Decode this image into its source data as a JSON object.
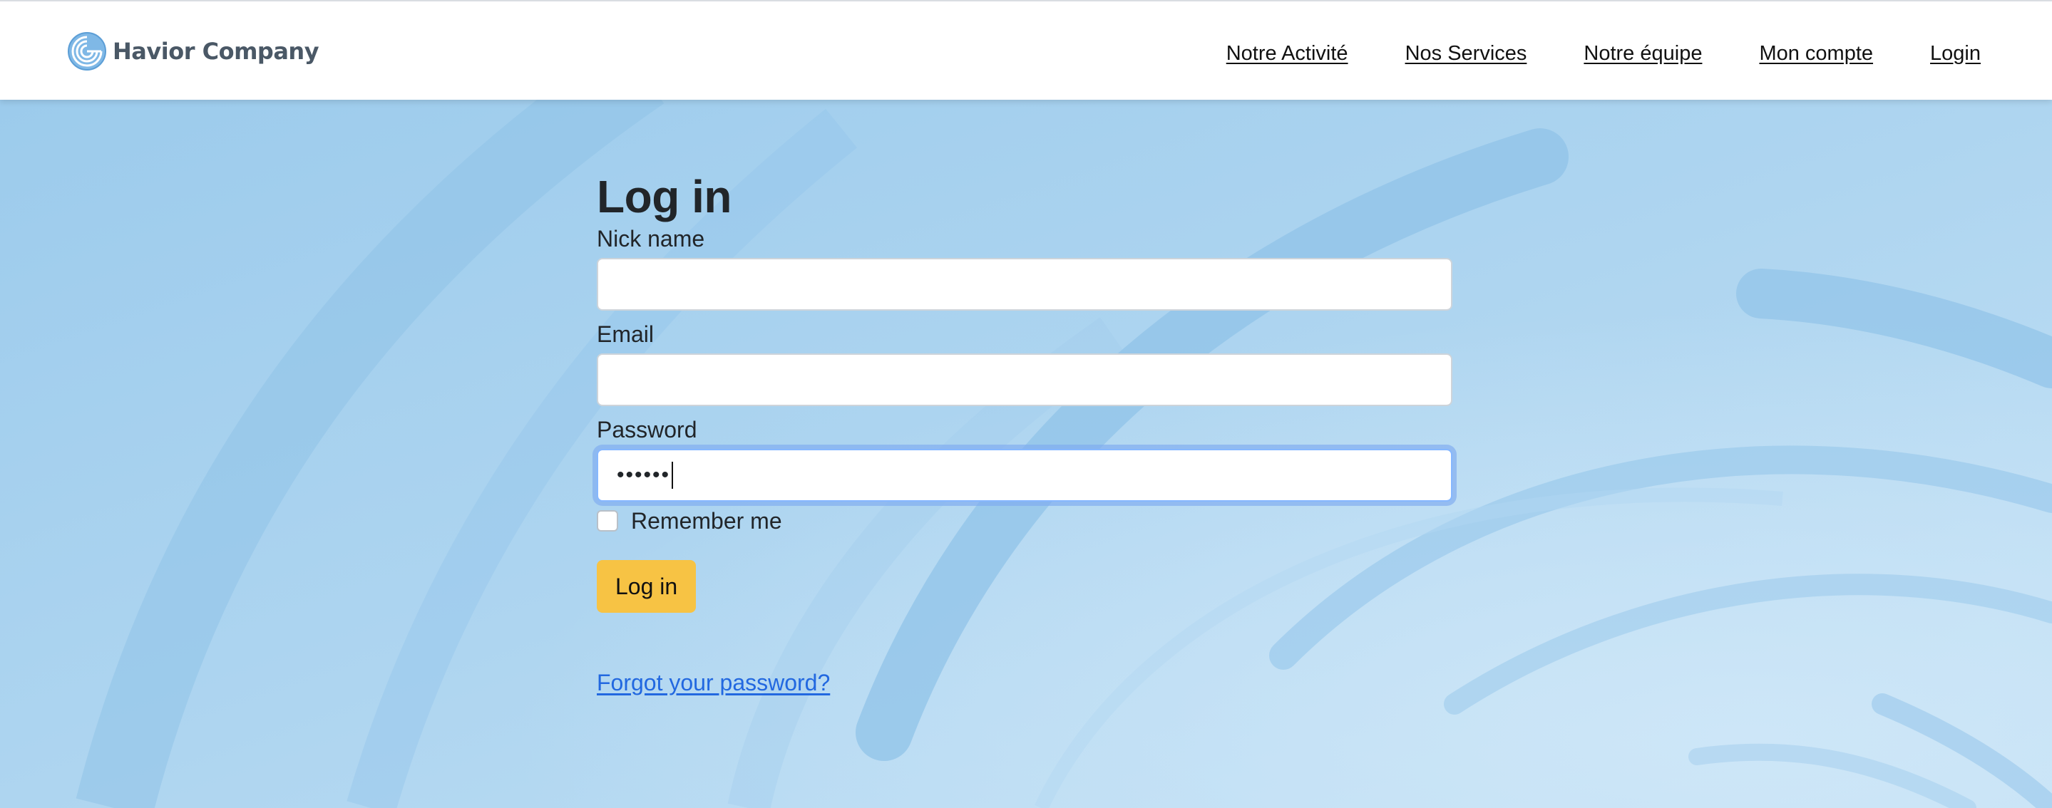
{
  "brand": {
    "name": "Havior Company"
  },
  "nav": {
    "items": [
      {
        "label": "Notre Activité"
      },
      {
        "label": "Nos Services"
      },
      {
        "label": "Notre équipe"
      },
      {
        "label": "Mon compte"
      },
      {
        "label": "Login"
      }
    ]
  },
  "login": {
    "title": "Log in",
    "nickname": {
      "label": "Nick name",
      "value": ""
    },
    "email": {
      "label": "Email",
      "value": ""
    },
    "password": {
      "label": "Password",
      "masked_value": "••••••"
    },
    "remember_me": {
      "label": "Remember me",
      "checked": false
    },
    "submit_label": "Log in",
    "forgot_link": "Forgot your password?"
  },
  "colors": {
    "background": "#a9d0ee",
    "button": "#f7c344",
    "link": "#2268e0",
    "focus_ring": "#86b7fe"
  },
  "icons": {
    "logo": "spiral-logo-icon"
  }
}
